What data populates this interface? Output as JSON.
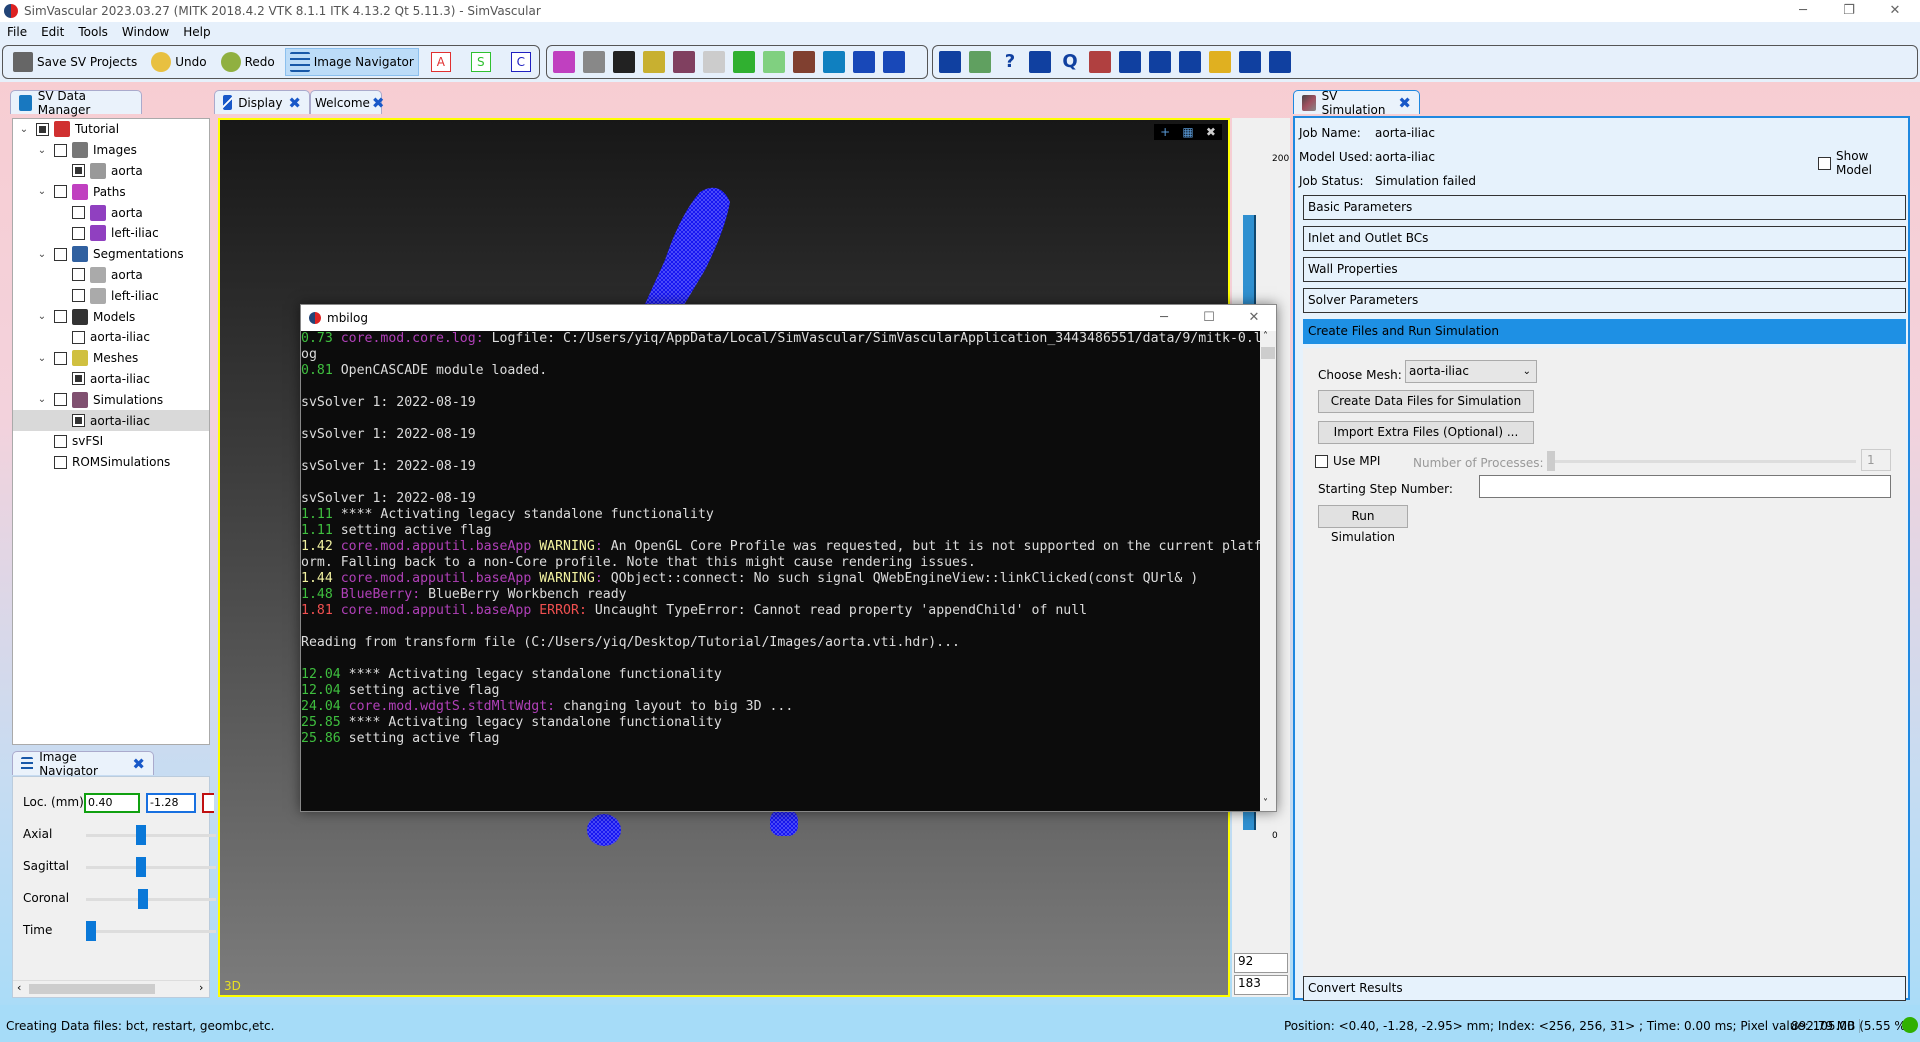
{
  "window": {
    "title": "SimVascular 2023.03.27 (MITK 2018.4.2 VTK 8.1.1 ITK 4.13.2 Qt 5.11.3) - SimVascular",
    "minimize": "─",
    "restore": "❐",
    "close": "✕"
  },
  "menu": [
    "File",
    "Edit",
    "Tools",
    "Window",
    "Help"
  ],
  "toolbar": {
    "save": "Save SV Projects",
    "undo": "Undo",
    "redo": "Redo",
    "image_navigator": "Image Navigator",
    "letters": [
      {
        "t": "A",
        "c": "#e03030"
      },
      {
        "t": "S",
        "c": "#30c030"
      },
      {
        "t": "C",
        "c": "#2020c0"
      }
    ],
    "tools": [
      {
        "name": "path-planning-icon",
        "c": "#c040c0"
      },
      {
        "name": "segmentation-icon",
        "c": "#888"
      },
      {
        "name": "modeling-icon",
        "c": "#222"
      },
      {
        "name": "meshing-icon",
        "c": "#c8b030"
      },
      {
        "name": "simulation-icon",
        "c": "#804060"
      },
      {
        "name": "axes-icon",
        "c": "#ccc"
      },
      {
        "name": "results-icon",
        "c": "#30b030"
      },
      {
        "name": "rom-icon",
        "c": "#80d080"
      },
      {
        "name": "fsi-icon",
        "c": "#804030"
      },
      {
        "name": "cabinet-icon",
        "c": "#1080c0"
      },
      {
        "name": "pencil-icon",
        "c": "#1848b8"
      },
      {
        "name": "wrench-icon",
        "c": "#1848b8"
      }
    ],
    "tools2": [
      {
        "name": "box-icon",
        "c": "#1040a0"
      },
      {
        "name": "transfer-icon",
        "c": "#60a060"
      },
      {
        "name": "help-icon",
        "c": "#1040a0",
        "g": "?"
      },
      {
        "name": "help-list-icon",
        "c": "#1040a0"
      },
      {
        "name": "search-help-icon",
        "c": "#1040a0",
        "g": "Q"
      },
      {
        "name": "brush-icon",
        "c": "#b04040"
      },
      {
        "name": "log-icon",
        "c": "#1040a0"
      },
      {
        "name": "tools-icon",
        "c": "#1040a0"
      },
      {
        "name": "list-icon",
        "c": "#1040a0"
      },
      {
        "name": "python-icon",
        "c": "#e0b020"
      },
      {
        "name": "chart-icon",
        "c": "#1040a0"
      },
      {
        "name": "eye-icon",
        "c": "#1040a0"
      }
    ]
  },
  "data_manager": {
    "tab": "SV Data Manager",
    "tree": [
      {
        "label": "Tutorial",
        "level": 0,
        "expanded": true,
        "checked": true,
        "icon": "#d03030"
      },
      {
        "label": "Images",
        "level": 1,
        "expanded": true,
        "checked": false,
        "icon": "#777"
      },
      {
        "label": "aorta",
        "level": 2,
        "checked": true,
        "icon": "#999"
      },
      {
        "label": "Paths",
        "level": 1,
        "expanded": true,
        "checked": false,
        "icon": "#c040c0"
      },
      {
        "label": "aorta",
        "level": 2,
        "checked": false,
        "icon": "#9040c0"
      },
      {
        "label": "left-iliac",
        "level": 2,
        "checked": false,
        "icon": "#9040c0"
      },
      {
        "label": "Segmentations",
        "level": 1,
        "expanded": true,
        "checked": false,
        "icon": "#3060a0"
      },
      {
        "label": "aorta",
        "level": 2,
        "checked": false,
        "icon": "#aaa"
      },
      {
        "label": "left-iliac",
        "level": 2,
        "checked": false,
        "icon": "#aaa"
      },
      {
        "label": "Models",
        "level": 1,
        "expanded": true,
        "checked": false,
        "icon": "#333"
      },
      {
        "label": "aorta-iliac",
        "level": 2,
        "checked": false,
        "noicon": true
      },
      {
        "label": "Meshes",
        "level": 1,
        "expanded": true,
        "checked": false,
        "icon": "#d0c040"
      },
      {
        "label": "aorta-iliac",
        "level": 2,
        "checked": true,
        "noicon": true
      },
      {
        "label": "Simulations",
        "level": 1,
        "expanded": true,
        "checked": false,
        "icon": "#805070"
      },
      {
        "label": "aorta-iliac",
        "level": 2,
        "checked": true,
        "noicon": true,
        "selected": true
      },
      {
        "label": "svFSI",
        "level": 1,
        "checked": false,
        "noicon": true,
        "leaf": true
      },
      {
        "label": "ROMSimulations",
        "level": 1,
        "checked": false,
        "noicon": true,
        "leaf": true
      }
    ]
  },
  "image_navigator": {
    "tab": "Image Navigator",
    "loc_label": "Loc. (mm)",
    "loc_x": "0.40",
    "loc_y": "-1.28",
    "sliders": [
      {
        "label": "Axial",
        "value": 0.5
      },
      {
        "label": "Sagittal",
        "value": 0.5
      },
      {
        "label": "Coronal",
        "value": 0.52
      },
      {
        "label": "Time",
        "value": 0
      }
    ]
  },
  "display": {
    "tabs": [
      "Display",
      "Welcome"
    ],
    "view_label": "3D",
    "ruler_labels": [
      "200",
      "0"
    ],
    "ruler_boxes": [
      "92",
      "183"
    ],
    "level_window": {
      "min": 0,
      "max": 200
    }
  },
  "mbilog": {
    "title": "mbilog",
    "lines": [
      {
        "time": "0.73",
        "tc": "green",
        "mod": "core.mod.core.log",
        "text": " Logfile: C:/Users/yiq/AppData/Local/SimVascular/SimVascularApplication_3443486551/data/9/mitk-0.log"
      },
      {
        "time": "0.81",
        "tc": "green",
        "text": " OpenCASCADE module loaded."
      },
      {
        "text": ""
      },
      {
        "text": "svSolver 1: 2022-08-19"
      },
      {
        "text": ""
      },
      {
        "text": "svSolver 1: 2022-08-19"
      },
      {
        "text": ""
      },
      {
        "text": "svSolver 1: 2022-08-19"
      },
      {
        "text": ""
      },
      {
        "text": "svSolver 1: 2022-08-19"
      },
      {
        "time": "1.11",
        "tc": "green",
        "text": " **** Activating legacy standalone functionality"
      },
      {
        "time": "1.11",
        "tc": "green",
        "text": " setting active flag"
      },
      {
        "time": "1.42",
        "tc": "yellow",
        "mod": "core.mod.apputil.baseApp",
        "lvl": "WARNING",
        "text": " An OpenGL Core Profile was requested, but it is not supported on the current platform. Falling back to a non-Core profile. Note that this might cause rendering issues."
      },
      {
        "time": "1.44",
        "tc": "yellow",
        "mod": "core.mod.apputil.baseApp",
        "lvl": "WARNING",
        "text": " QObject::connect: No such signal QWebEngineView::linkClicked(const QUrl& )"
      },
      {
        "time": "1.48",
        "tc": "green",
        "mod": "BlueBerry",
        "text": " BlueBerry Workbench ready"
      },
      {
        "time": "1.81",
        "tc": "red",
        "mod": "core.mod.apputil.baseApp",
        "lvl": "ERROR",
        "text": " Uncaught TypeError: Cannot read property 'appendChild' of null"
      },
      {
        "text": ""
      },
      {
        "text": "Reading from transform file (C:/Users/yiq/Desktop/Tutorial/Images/aorta.vti.hdr)..."
      },
      {
        "text": ""
      },
      {
        "time": "12.04",
        "tc": "green",
        "text": " **** Activating legacy standalone functionality"
      },
      {
        "time": "12.04",
        "tc": "green",
        "text": " setting active flag"
      },
      {
        "time": "24.04",
        "tc": "green",
        "mod": "core.mod.wdgtS.stdMltWdgt",
        "text": " changing layout to big 3D ..."
      },
      {
        "time": "25.85",
        "tc": "green",
        "text": " **** Activating legacy standalone functionality"
      },
      {
        "time": "25.86",
        "tc": "green",
        "text": " setting active flag"
      }
    ]
  },
  "simulation": {
    "tab": "SV Simulation",
    "job_name_label": "Job Name:",
    "job_name": "aorta-iliac",
    "model_label": "Model Used:",
    "model": "aorta-iliac",
    "status_label": "Job Status:",
    "status": "Simulation failed",
    "show_model": "Show Model",
    "sections": [
      "Basic Parameters",
      "Inlet and Outlet BCs",
      "Wall Properties",
      "Solver Parameters",
      "Create Files and Run Simulation"
    ],
    "choose_mesh_label": "Choose Mesh:",
    "choose_mesh": "aorta-iliac",
    "create_btn": "Create Data Files for Simulation",
    "import_btn": "Import Extra Files (Optional) ...",
    "use_mpi": "Use MPI",
    "nproc_label": "Number of Processes:",
    "nproc": "1",
    "start_step_label": "Starting Step Number:",
    "start_step": "",
    "run_btn": "Run Simulation",
    "convert": "Convert Results",
    "accent": "#1e90e4"
  },
  "status": {
    "left": "Creating Data files: bct, restart, geombc,etc.",
    "right": "Position: <0.40, -1.28, -2.95> mm; Index: <256, 256, 31> ; Time: 0.00 ms; Pixel value: 105.00",
    "memory": "892.79 MB (5.55 %)",
    "indicator_color": "#30b000"
  }
}
